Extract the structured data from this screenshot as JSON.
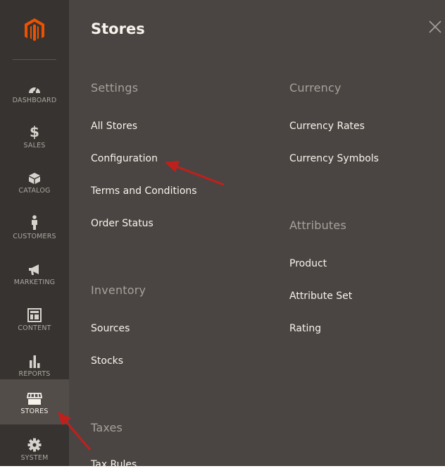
{
  "sidebar": {
    "logo": "magento-logo",
    "items": [
      {
        "label": "DASHBOARD",
        "icon": "dashboard-icon"
      },
      {
        "label": "SALES",
        "icon": "dollar-icon"
      },
      {
        "label": "CATALOG",
        "icon": "box-icon"
      },
      {
        "label": "CUSTOMERS",
        "icon": "person-icon"
      },
      {
        "label": "MARKETING",
        "icon": "megaphone-icon"
      },
      {
        "label": "CONTENT",
        "icon": "layout-icon"
      },
      {
        "label": "REPORTS",
        "icon": "bar-chart-icon"
      },
      {
        "label": "STORES",
        "icon": "storefront-icon"
      },
      {
        "label": "SYSTEM",
        "icon": "gear-icon"
      }
    ],
    "active": "STORES"
  },
  "panel": {
    "title": "Stores",
    "left_column": {
      "settings": {
        "title": "Settings",
        "links": [
          "All Stores",
          "Configuration",
          "Terms and Conditions",
          "Order Status"
        ]
      },
      "inventory": {
        "title": "Inventory",
        "links": [
          "Sources",
          "Stocks"
        ]
      },
      "taxes": {
        "title": "Taxes",
        "links": [
          "Tax Rules"
        ]
      }
    },
    "right_column": {
      "currency": {
        "title": "Currency",
        "links": [
          "Currency Rates",
          "Currency Symbols"
        ]
      },
      "attributes": {
        "title": "Attributes",
        "links": [
          "Product",
          "Attribute Set",
          "Rating"
        ]
      }
    }
  },
  "colors": {
    "sidebar_bg": "#373330",
    "panel_bg": "#4a4542",
    "active_item_bg": "#524d49",
    "logo_orange": "#eb5202",
    "annotation_arrow": "#c0201c"
  }
}
